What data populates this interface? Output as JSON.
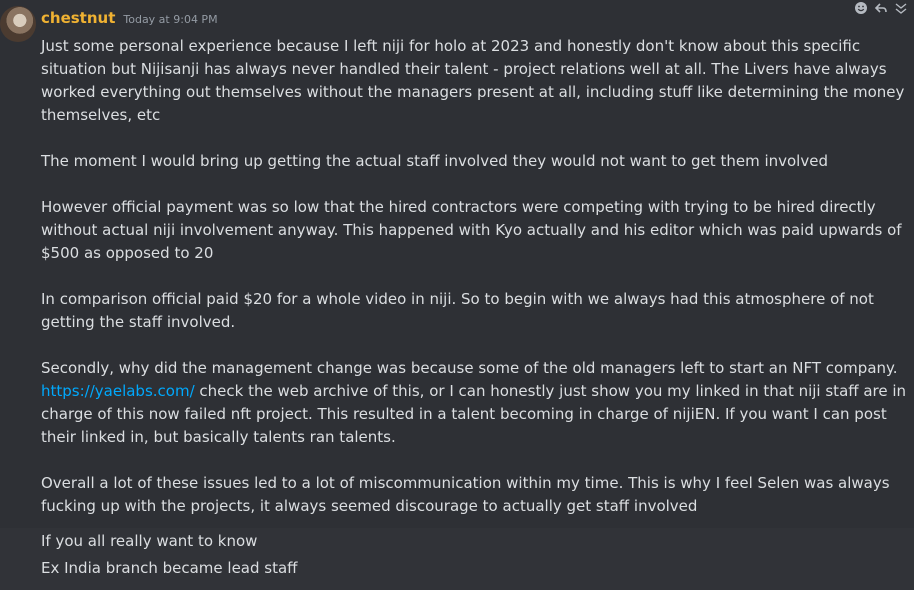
{
  "message": {
    "username": "chestnut",
    "timestamp": "Today at 9:04 PM",
    "paragraphs": {
      "p1": "Just some personal experience because I left niji for holo at 2023 and honestly don't know about this specific situation but Nijisanji has always never handled their talent - project relations well at all. The Livers have always worked everything out themselves without the managers present at all, including stuff like determining the money themselves, etc",
      "p2": "The moment I would bring up getting the actual staff involved they would not want to get them involved",
      "p3": "However official payment was so low that the hired contractors were competing with trying to be hired directly without actual niji involvement anyway. This happened with Kyo actually and his editor which was paid upwards of $500 as opposed to 20",
      "p4": "In comparison official paid $20 for a whole video in niji. So to begin with we always had this atmosphere of not getting the staff involved.",
      "p5_start": "Secondly, why did the management change was because some of the old managers left to start an NFT company.",
      "p5_link": "https://yaelabs.com/",
      "p5_end": " check the web archive of this, or I can honestly just show you my linked in that niji staff are in charge of this now failed nft project. This resulted in a talent becoming in charge of nijiEN. If you want I can post their linked in, but basically talents ran talents.",
      "p6": "Overall a lot of these issues led to a lot of miscommunication within my time. This is why I feel Selen was always fucking up with the projects, it always seemed discourage to actually get staff involved"
    },
    "followups": [
      "If you all really want to know",
      "Ex India branch became lead staff"
    ]
  },
  "actions": {
    "icons": [
      "add-reaction-icon",
      "reply-icon",
      "more-icon"
    ]
  },
  "colors": {
    "background": "#313338",
    "username": "#f0b232",
    "link": "#00a8fc",
    "text": "#dbdee1",
    "timestamp": "#949ba4"
  }
}
